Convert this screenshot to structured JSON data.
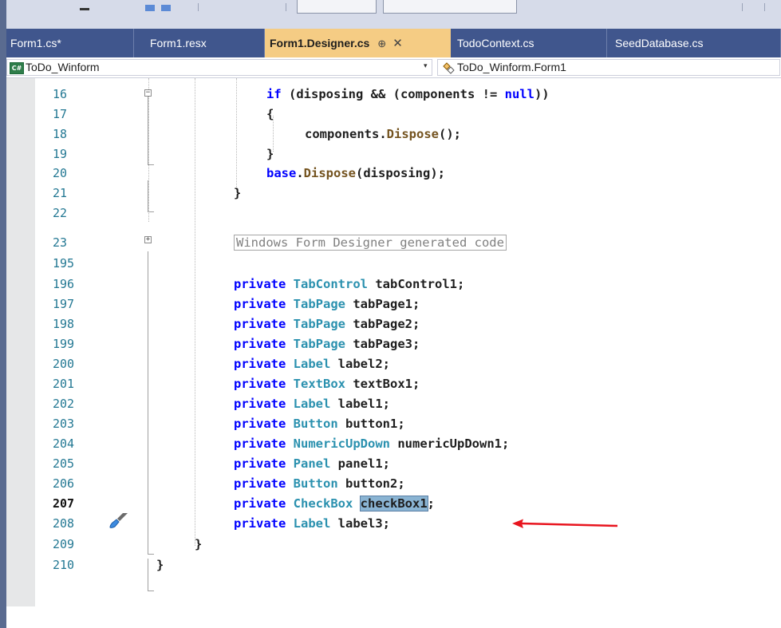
{
  "tabs": [
    {
      "label": "Form1.cs*"
    },
    {
      "label": "Form1.resx"
    },
    {
      "label": "Form1.Designer.cs",
      "pin": "⊕",
      "close": "✕"
    },
    {
      "label": "TodoContext.cs"
    },
    {
      "label": "SeedDatabase.cs"
    }
  ],
  "nav": {
    "project_badge": "C#",
    "project": "ToDo_Winform",
    "dropdown_arrow": "▾",
    "member": "ToDo_Winform.Form1"
  },
  "icons": [
    "cs-project-icon",
    "form-class-icon",
    "fold-toggle-icon",
    "quick-actions-brush-icon",
    "red-arrow-annotation"
  ],
  "colors": {
    "active_tab": "#f5cc84",
    "tabstrip": "#40568d",
    "keyword": "#0000ff",
    "type": "#2b91af",
    "method": "#74531f",
    "selection": "#8ab4d3",
    "annotation_arrow": "#e8141e"
  },
  "lines": [
    {
      "num": "16",
      "text": "if (disposing && (components != null))"
    },
    {
      "num": "17",
      "text": "{"
    },
    {
      "num": "18",
      "text": "components.Dispose();"
    },
    {
      "num": "19",
      "text": "}"
    },
    {
      "num": "20",
      "text": "base.Dispose(disposing);"
    },
    {
      "num": "21",
      "text": "}"
    },
    {
      "num": "22",
      "text": ""
    },
    {
      "num": "23",
      "text": "Windows Form Designer generated code"
    },
    {
      "num": "195",
      "text": ""
    },
    {
      "num": "196",
      "text": "private TabControl tabControl1;"
    },
    {
      "num": "197",
      "text": "private TabPage tabPage1;"
    },
    {
      "num": "198",
      "text": "private TabPage tabPage2;"
    },
    {
      "num": "199",
      "text": "private TabPage tabPage3;"
    },
    {
      "num": "200",
      "text": "private Label label2;"
    },
    {
      "num": "201",
      "text": "private TextBox textBox1;"
    },
    {
      "num": "202",
      "text": "private Label label1;"
    },
    {
      "num": "203",
      "text": "private Button button1;"
    },
    {
      "num": "204",
      "text": "private NumericUpDown numericUpDown1;"
    },
    {
      "num": "205",
      "text": "private Panel panel1;"
    },
    {
      "num": "206",
      "text": "private Button button2;"
    },
    {
      "num": "207",
      "text": "private CheckBox checkBox1;"
    },
    {
      "num": "208",
      "text": "private Label label3;"
    },
    {
      "num": "209",
      "text": "}"
    },
    {
      "num": "210",
      "text": "}"
    }
  ],
  "tokens": {
    "if": "if",
    "open_paren": " (disposing && (components != ",
    "null": "null",
    "close_parens": "))",
    "lbrace": "{",
    "rbrace": "}",
    "components": "components.",
    "dispose": "Dispose",
    "dispose_tail": "();",
    "base": "base",
    "base_dot": ".",
    "disposing_arg": "(disposing);",
    "region": "Windows Form Designer generated code",
    "private": "private",
    "t_tabcontrol": "TabControl",
    "n_tabcontrol": " tabControl1;",
    "t_tabpage": "TabPage",
    "n_tabpage1": " tabPage1;",
    "n_tabpage2": " tabPage2;",
    "n_tabpage3": " tabPage3;",
    "t_label": "Label",
    "n_label2": " label2;",
    "n_label1": " label1;",
    "n_label3": " label3;",
    "t_textbox": "TextBox",
    "n_textbox": " textBox1;",
    "t_button": "Button",
    "n_button1": " button1;",
    "n_button2": " button2;",
    "t_numeric": "NumericUpDown",
    "n_numeric": " numericUpDown1;",
    "t_panel": "Panel",
    "n_panel": " panel1;",
    "t_checkbox": "CheckBox",
    "n_checkbox_sel": "checkBox1",
    "semicolon": ";",
    "fold_minus": "−",
    "fold_plus": "+"
  }
}
